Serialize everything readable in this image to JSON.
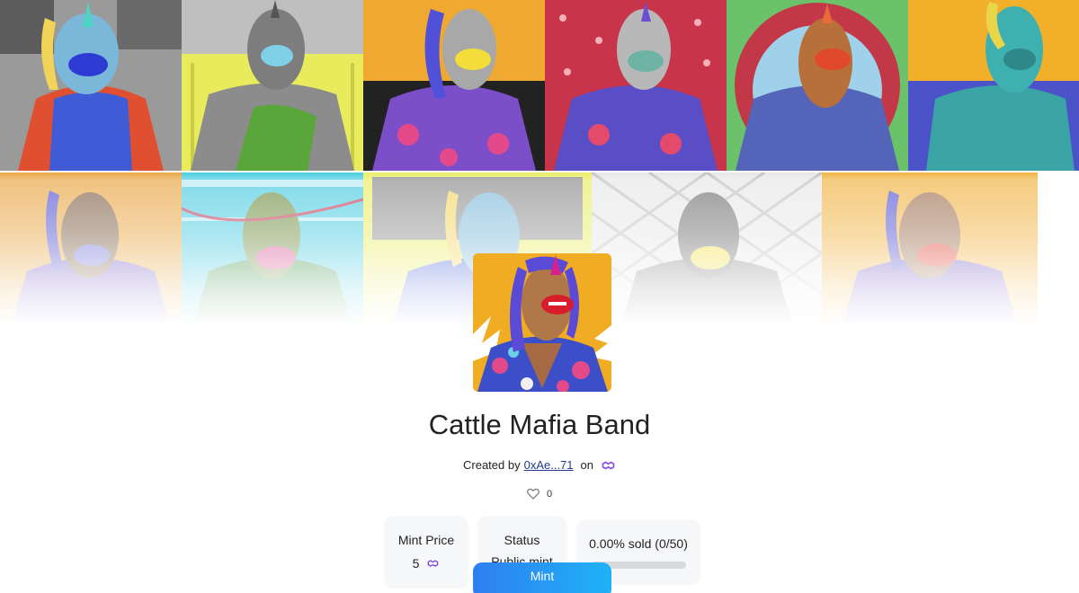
{
  "collection": {
    "name": "Cattle Mafia Band",
    "created_by_label": "Created by",
    "creator_address": "0xAe...71",
    "on_label": "on",
    "chain_icon": "polygon-icon",
    "likes": "0"
  },
  "stats": {
    "mint_price_label": "Mint Price",
    "mint_price_value": "5",
    "status_label": "Status",
    "status_value": "Public mint",
    "sold_label": "0.00% sold (0/50)",
    "sold_fraction": 0
  },
  "actions": {
    "mint_label": "Mint"
  },
  "colors": {
    "accent_start": "#2f7ff2",
    "accent_end": "#1fb2f7",
    "chain_purple": "#8247e5",
    "link": "#1f3b8f"
  }
}
